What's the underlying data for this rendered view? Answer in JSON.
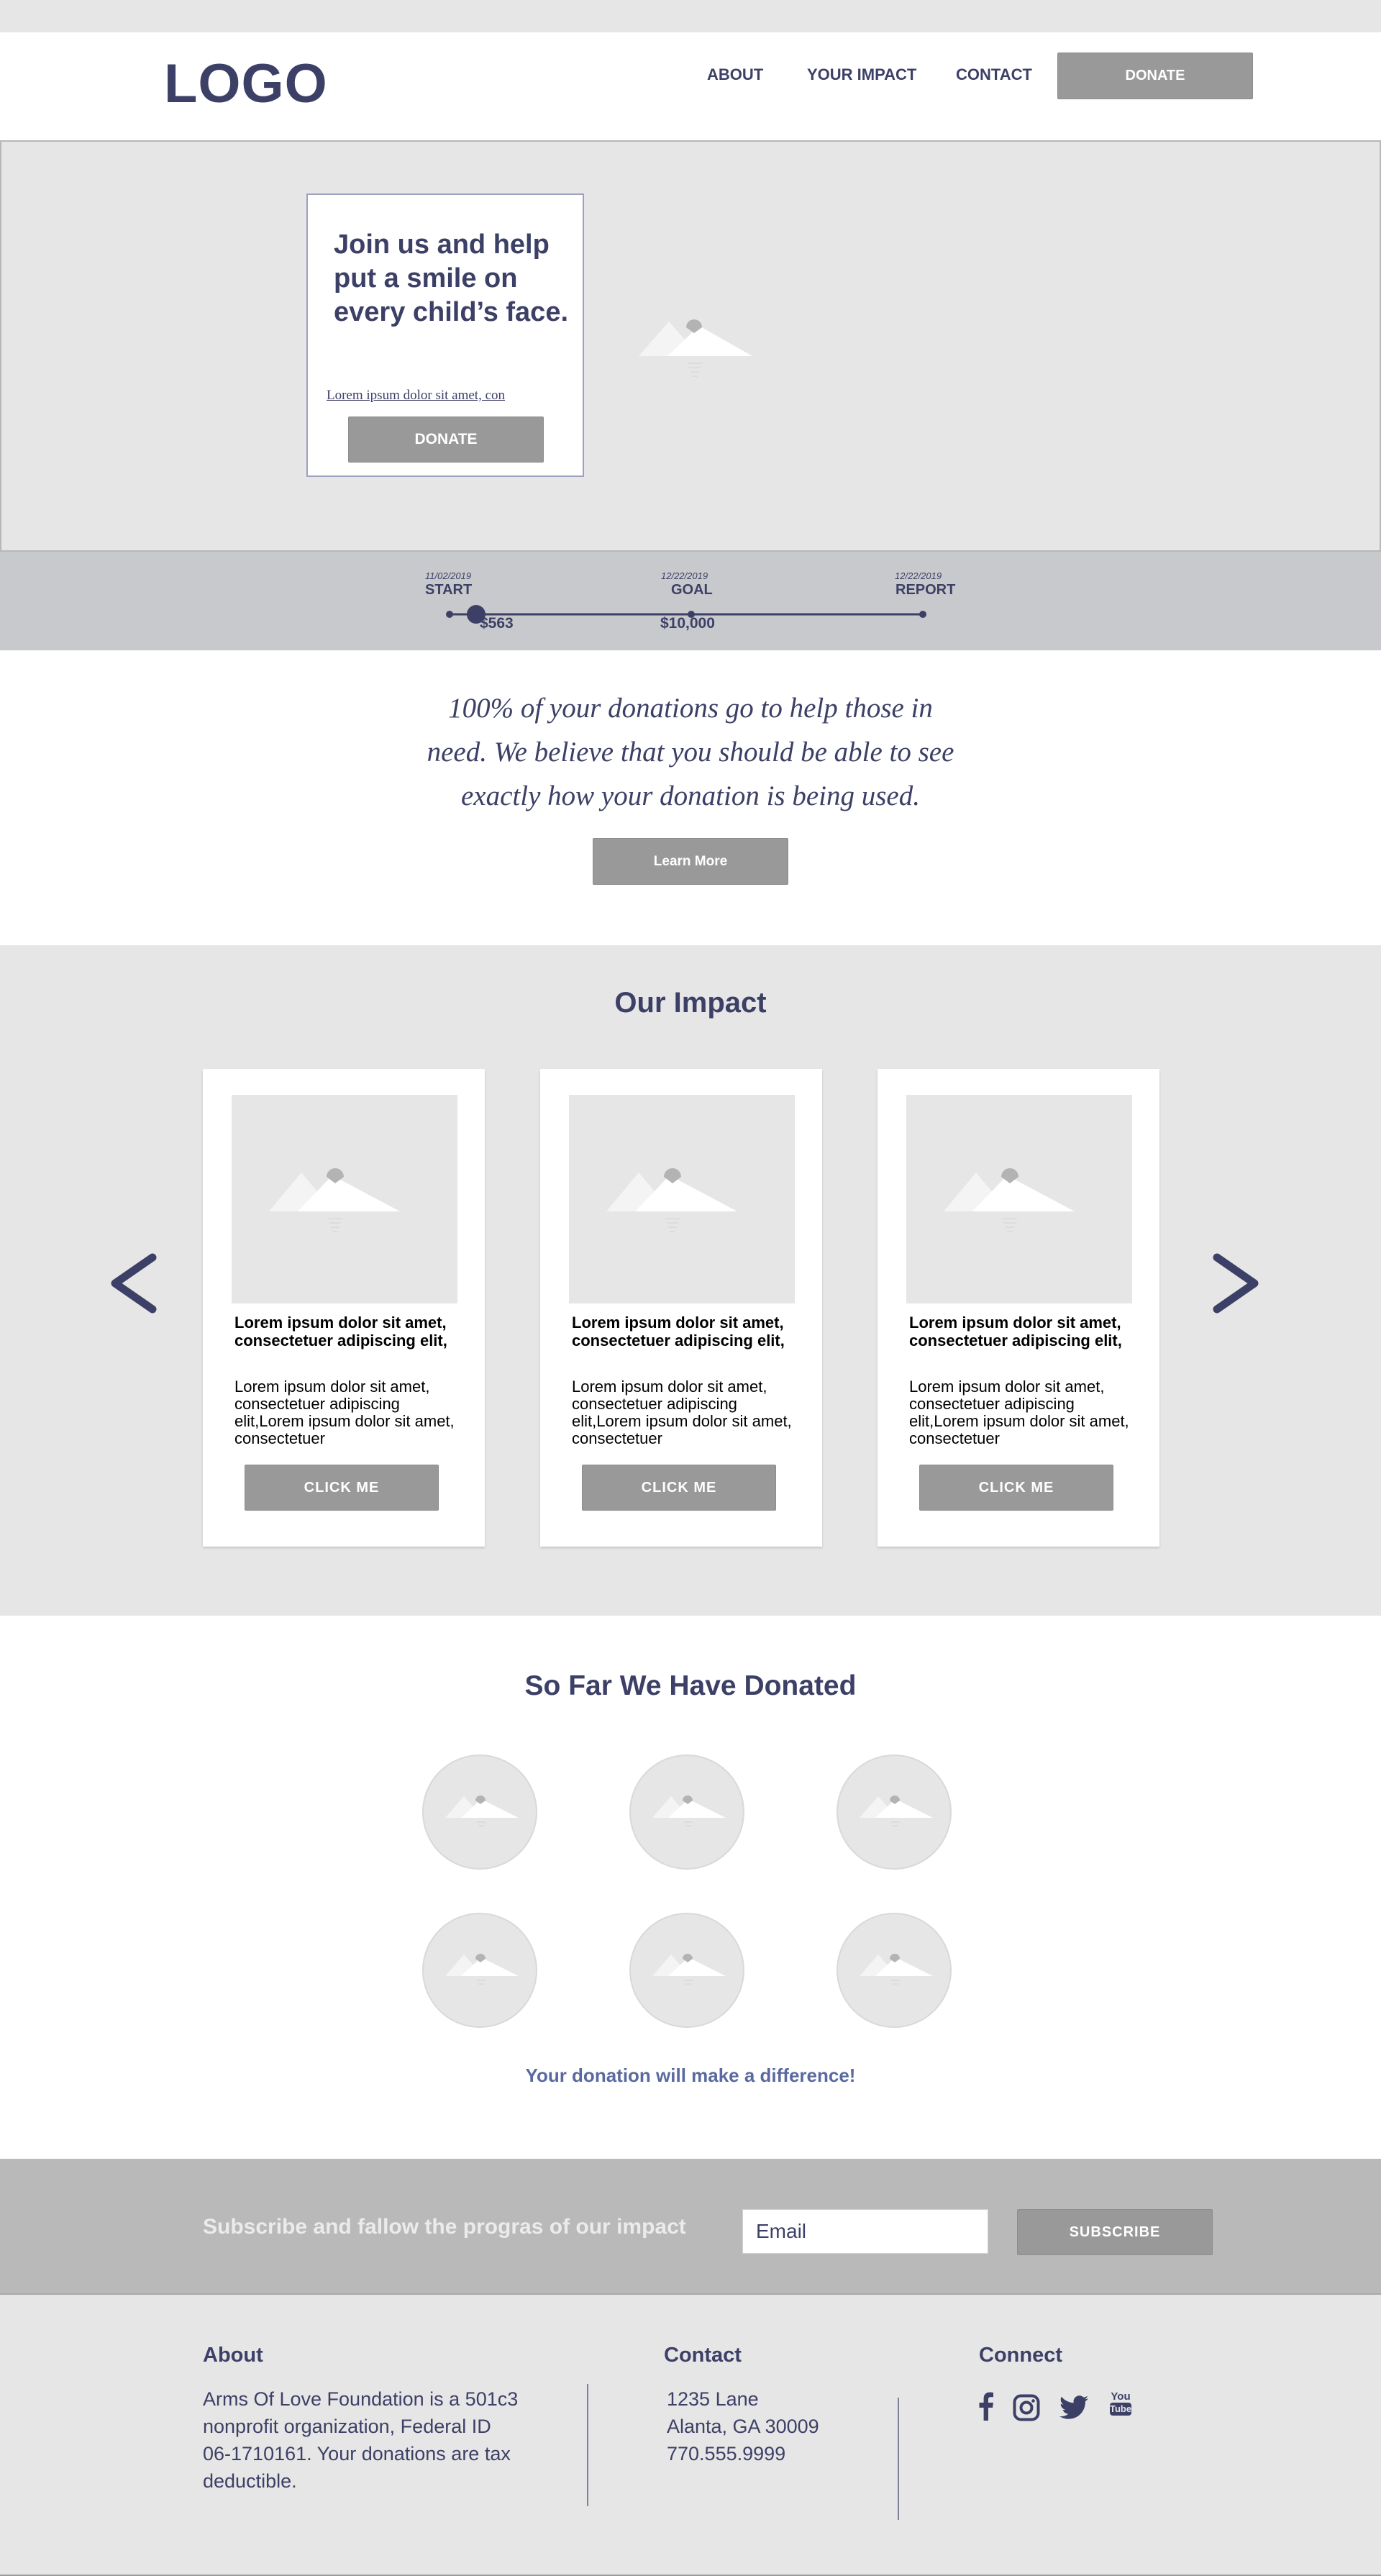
{
  "header": {
    "logo": "LOGO",
    "nav": [
      "ABOUT",
      "YOUR IMPACT",
      "CONTACT"
    ],
    "donate_label": "DONATE"
  },
  "hero": {
    "title": "Join us and help put a smile on every child’s face.",
    "link_text": "Lorem ipsum dolor sit amet, con",
    "donate_label": "DONATE"
  },
  "timeline": {
    "progress_fraction": 0.11,
    "start": {
      "date": "11/02/2019",
      "label": "START"
    },
    "goal": {
      "date": "12/22/2019",
      "label": "GOAL",
      "amount": "$10,000"
    },
    "report": {
      "date": "12/22/2019",
      "label": "REPORT"
    },
    "raised": "$563"
  },
  "mission": {
    "line1": "100% of your donations go to help those in",
    "line2": "need. We believe that you should be able to see",
    "line3": "exactly how your donation is being used.",
    "button_label": "Learn More"
  },
  "impact": {
    "title": "Our Impact",
    "cards": [
      {
        "heading": "Lorem ipsum dolor sit amet, consectetuer adipiscing elit,",
        "body": "Lorem ipsum dolor sit amet, consectetuer adipiscing elit,Lorem ipsum dolor sit amet, consectetuer",
        "button": "CLICK ME"
      },
      {
        "heading": "Lorem ipsum dolor sit amet, consectetuer adipiscing elit,",
        "body": "Lorem ipsum dolor sit amet, consectetuer adipiscing elit,Lorem ipsum dolor sit amet, consectetuer",
        "button": "CLICK ME"
      },
      {
        "heading": "Lorem ipsum dolor sit amet, consectetuer adipiscing elit,",
        "body": "Lorem ipsum dolor sit amet, consectetuer adipiscing elit,Lorem ipsum dolor sit amet, consectetuer",
        "button": "CLICK ME"
      }
    ]
  },
  "donated": {
    "title": "So Far We Have Donated",
    "tagline": "Your donation will make a difference!"
  },
  "subscribe": {
    "text": "Subscribe and fallow the progras of our impact",
    "placeholder": "Email",
    "button_label": "SUBSCRIBE"
  },
  "footer": {
    "about": {
      "heading": "About",
      "lines": [
        "Arms Of Love Foundation is a 501c3",
        "nonprofit organization, Federal ID",
        "06-1710161. Your donations are tax",
        "deductible."
      ]
    },
    "contact": {
      "heading": "Contact",
      "lines": [
        "1235 Lane",
        "Alanta, GA 30009",
        "770.555.9999"
      ]
    },
    "connect": {
      "heading": "Connect",
      "icons": [
        "facebook-icon",
        "instagram-icon",
        "twitter-icon",
        "youtube-icon"
      ],
      "youtube_top": "You",
      "youtube_bottom": "Tube"
    }
  },
  "colors": {
    "navy": "#3d4066",
    "button_grey": "#999999",
    "light_grey": "#e6e6e6",
    "link_blue": "#5a6aa0"
  }
}
